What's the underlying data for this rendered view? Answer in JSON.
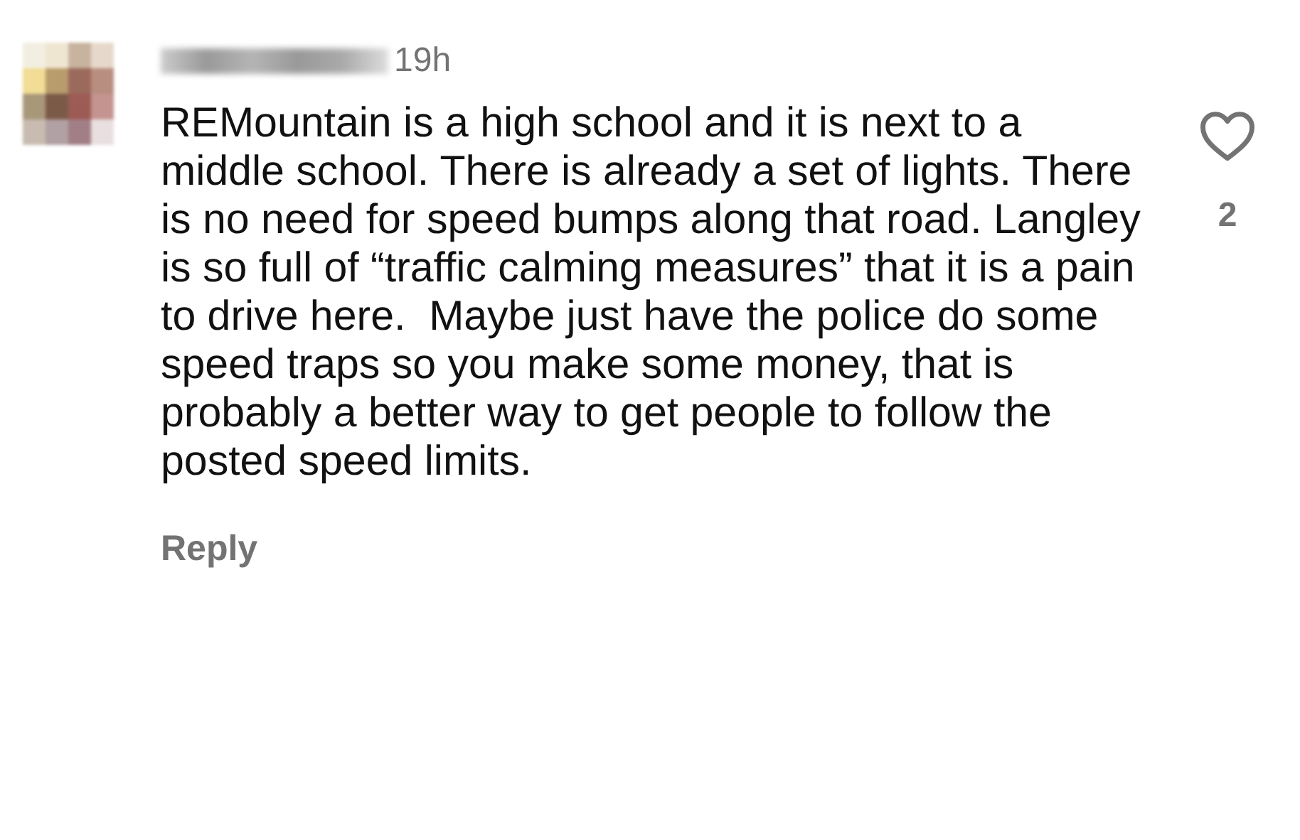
{
  "comment": {
    "time": "19h",
    "text": "REMountain is a high school and it is next to a middle school. There is already a set of lights. There is no need for speed bumps along that road. Langley is so full of “traffic calming measures” that it is a pain to drive here.  Maybe just have the police do some speed traps so you make some money, that is probably a better way to get people to follow the posted speed limits.",
    "reply": "Reply",
    "like_count": "2",
    "liked": false
  }
}
